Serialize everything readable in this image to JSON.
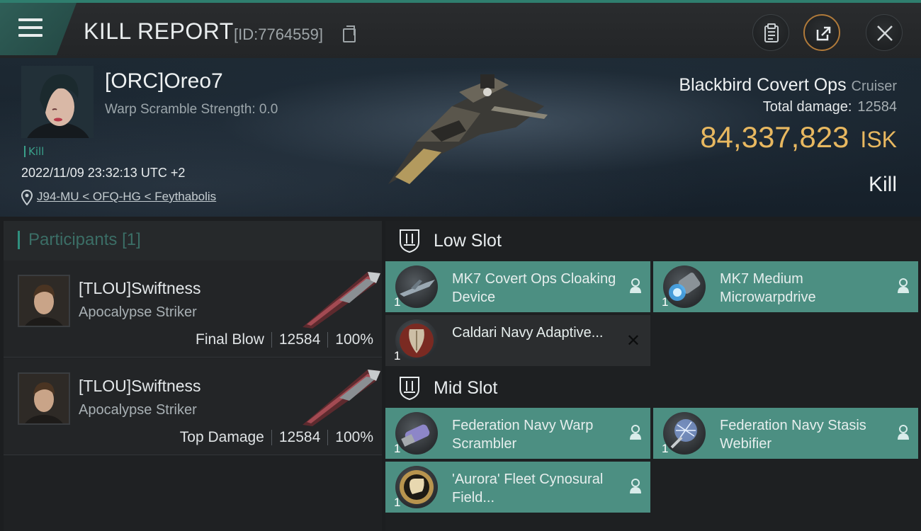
{
  "header": {
    "title": "KILL REPORT",
    "report_id": "[ID:7764559]"
  },
  "victim": {
    "pilot": "[ORC]Oreo7",
    "warp_scramble": "Warp Scramble Strength: 0.0",
    "tag": "Kill",
    "datetime": "2022/11/09 23:32:13 UTC +2",
    "location": "J94-MU < OFQ-HG < Feythabolis",
    "ship_name": "Blackbird Covert Ops",
    "ship_class": "Cruiser",
    "total_damage_label": "Total damage:",
    "total_damage": "12584",
    "isk_value": "84,337,823",
    "isk_unit": "ISK",
    "result": "Kill"
  },
  "participants": {
    "label": "Participants",
    "count": "[1]",
    "rows": [
      {
        "name": "[TLOU]Swiftness",
        "ship": "Apocalypse Striker",
        "role": "Final Blow",
        "damage": "12584",
        "percent": "100%"
      },
      {
        "name": "[TLOU]Swiftness",
        "ship": "Apocalypse Striker",
        "role": "Top Damage",
        "damage": "12584",
        "percent": "100%"
      }
    ]
  },
  "slots": {
    "low": {
      "label": "Low Slot",
      "modules": [
        {
          "name": "MK7 Covert Ops Cloaking Device",
          "qty": "1",
          "status": "dropped"
        },
        {
          "name": "MK7 Medium Microwarpdrive",
          "qty": "1",
          "status": "dropped"
        },
        {
          "name": "Caldari Navy Adaptive...",
          "qty": "1",
          "status": "destroyed"
        }
      ]
    },
    "mid": {
      "label": "Mid Slot",
      "modules": [
        {
          "name": "Federation Navy Warp Scrambler",
          "qty": "1",
          "status": "dropped"
        },
        {
          "name": "Federation Navy Stasis Webifier",
          "qty": "1",
          "status": "dropped"
        },
        {
          "name": "'Aurora' Fleet Cynosural Field...",
          "qty": "1",
          "status": "dropped"
        }
      ]
    }
  },
  "colors": {
    "accent": "#2f8f7e",
    "dropped_bg": "#4c8f82",
    "destroyed_bg": "#2b2d2f",
    "isk": "#e8b860"
  },
  "icons": [
    "menu-icon",
    "copy-icon",
    "clipboard-icon",
    "share-icon",
    "close-icon",
    "location-pin-icon",
    "slot-icon",
    "person-icon"
  ]
}
